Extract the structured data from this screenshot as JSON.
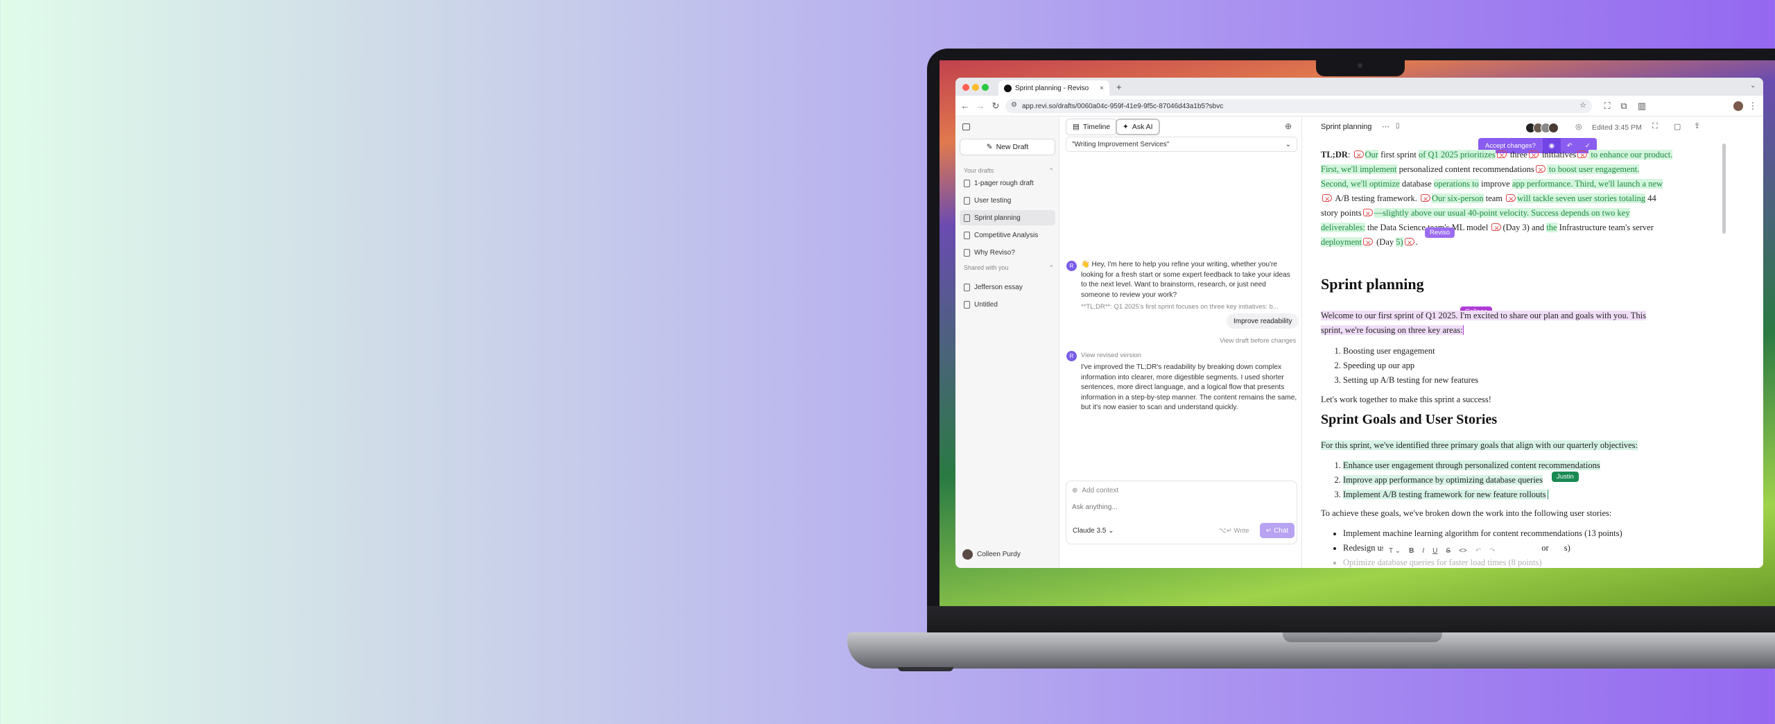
{
  "browser": {
    "tab_title": "Sprint planning - Reviso",
    "new_tab": "+",
    "url": "app.revi.so/drafts/0060a04c-959f-41e9-9f5c-87046d43a1b5?sbvc"
  },
  "sidebar": {
    "new_draft": "New Draft",
    "your_drafts_label": "Your drafts",
    "drafts": [
      "1-pager rough draft",
      "User testing",
      "Sprint planning",
      "Competitive Analysis",
      "Why Reviso?"
    ],
    "shared_label": "Shared with you",
    "shared": [
      "Jefferson essay",
      "Untitled"
    ],
    "user_name": "Colleen Purdy"
  },
  "chat": {
    "timeline_label": "Timeline",
    "ask_ai_label": "Ask AI",
    "selected_service": "\"Writing Improvement Services\"",
    "assistant_initial": "R",
    "welcome": "👋 Hey, I'm here to help you refine your writing, whether you're looking for a fresh start or some expert feedback to take your ideas to the next level. Want to brainstorm, research, or just need someone to review your work?",
    "quoted": "**TL;DR**: Q1 2025's first sprint focuses on three key initiatives: b...",
    "user_request": "Improve readability",
    "view_before": "View draft before changes",
    "view_revised": "View revised version",
    "reply": "I've improved the TL;DR's readability by breaking down complex information into clearer, more digestible segments. I used shorter sentences, more direct language, and a logical flow that presents information in a step-by-step manner. The content remains the same, but it's now easier to scan and understand quickly.",
    "add_context": "Add context",
    "placeholder": "Ask anything...",
    "model": "Claude 3.5",
    "write_label": "⌥↵ Write",
    "chat_label": "↵ Chat"
  },
  "editor": {
    "doc_title": "Sprint planning",
    "edited": "Edited 3:45 PM",
    "accept_changes": "Accept changes?",
    "tldr_label": "TL;DR",
    "tldr_lines": [
      [
        [
          "",
          ": "
        ],
        [
          "d",
          ""
        ],
        [
          "g",
          "Our"
        ],
        [
          "",
          " first sprint "
        ],
        [
          "g",
          "of Q1 2025 prioritizes"
        ],
        [
          "d",
          ""
        ],
        [
          "",
          " three"
        ],
        [
          "d",
          ""
        ],
        [
          "",
          " initiatives"
        ],
        [
          "d",
          ""
        ],
        [
          "g",
          " to enhance our product."
        ]
      ],
      [
        [
          "g",
          "First, we'll implement"
        ],
        [
          "",
          " personalized content recommendations"
        ],
        [
          "d",
          ""
        ],
        [
          "g",
          " to boost user engagement."
        ]
      ],
      [
        [
          "g",
          "Second, we'll optimize"
        ],
        [
          "",
          " database "
        ],
        [
          "g",
          "operations to"
        ],
        [
          "",
          " improve "
        ],
        [
          "g",
          "app performance. Third, we'll launch a new"
        ]
      ],
      [
        [
          "d",
          ""
        ],
        [
          "",
          " A/B testing framework. "
        ],
        [
          "d",
          ""
        ],
        [
          "g",
          "Our six-person"
        ],
        [
          "",
          " team "
        ],
        [
          "d",
          ""
        ],
        [
          "g",
          "will tackle seven user stories totaling"
        ],
        [
          "",
          " 44"
        ]
      ],
      [
        [
          "",
          "story points"
        ],
        [
          "d",
          ""
        ],
        [
          "g",
          "—slightly above our usual 40-point velocity. Success depends on two key"
        ]
      ],
      [
        [
          "g",
          "deliverables:"
        ],
        [
          "",
          " the Data Science team's ML model "
        ],
        [
          "d",
          ""
        ],
        [
          "",
          "(Day 3) and "
        ],
        [
          "g",
          "the"
        ],
        [
          "",
          " Infrastructure team's server"
        ]
      ],
      [
        [
          "g",
          "deployment"
        ],
        [
          "d",
          ""
        ],
        [
          "",
          " (Day "
        ],
        [
          "g",
          "5)"
        ],
        [
          "d",
          ""
        ],
        [
          "",
          "."
        ]
      ]
    ],
    "reviso_tag": "Reviso",
    "heading1": "Sprint planning",
    "colleen_tag": "Colleen",
    "welcome_line1": "Welcome to our first sprint of Q1 2025. I'm excited to share our plan and goals with you. This",
    "welcome_line2": "sprint, we're focusing on three key areas:",
    "focus_areas": [
      "Boosting user engagement",
      "Speeding up our app",
      "Setting up A/B testing for new features"
    ],
    "together": "Let's work together to make this sprint a success!",
    "heading2": "Sprint Goals and User Stories",
    "goals_intro": "For this sprint, we've identified three primary goals that align with our quarterly objectives:",
    "goals": [
      "Enhance user engagement through personalized content recommendations",
      "Improve app performance by optimizing database queries",
      "Implement A/B testing framework for new feature rollouts"
    ],
    "justin_tag": "Justin",
    "stories_intro": "To achieve these goals, we've broken down the work into the following user stories:",
    "stories": [
      "Implement machine learning algorithm for content recommendations (13 points)",
      "Redesign user profile p",
      "or"
    ],
    "story2_tail": "s)",
    "story3_partial": "Optimize database queries for faster load times (8 points)"
  },
  "colors": {
    "accent": "#8a5cf0",
    "added_bg": "#d3f5dd",
    "added_text": "#1c8a3f",
    "deleted": "#e04848",
    "colleen": "#b03ad6",
    "justin": "#1a8a53"
  }
}
